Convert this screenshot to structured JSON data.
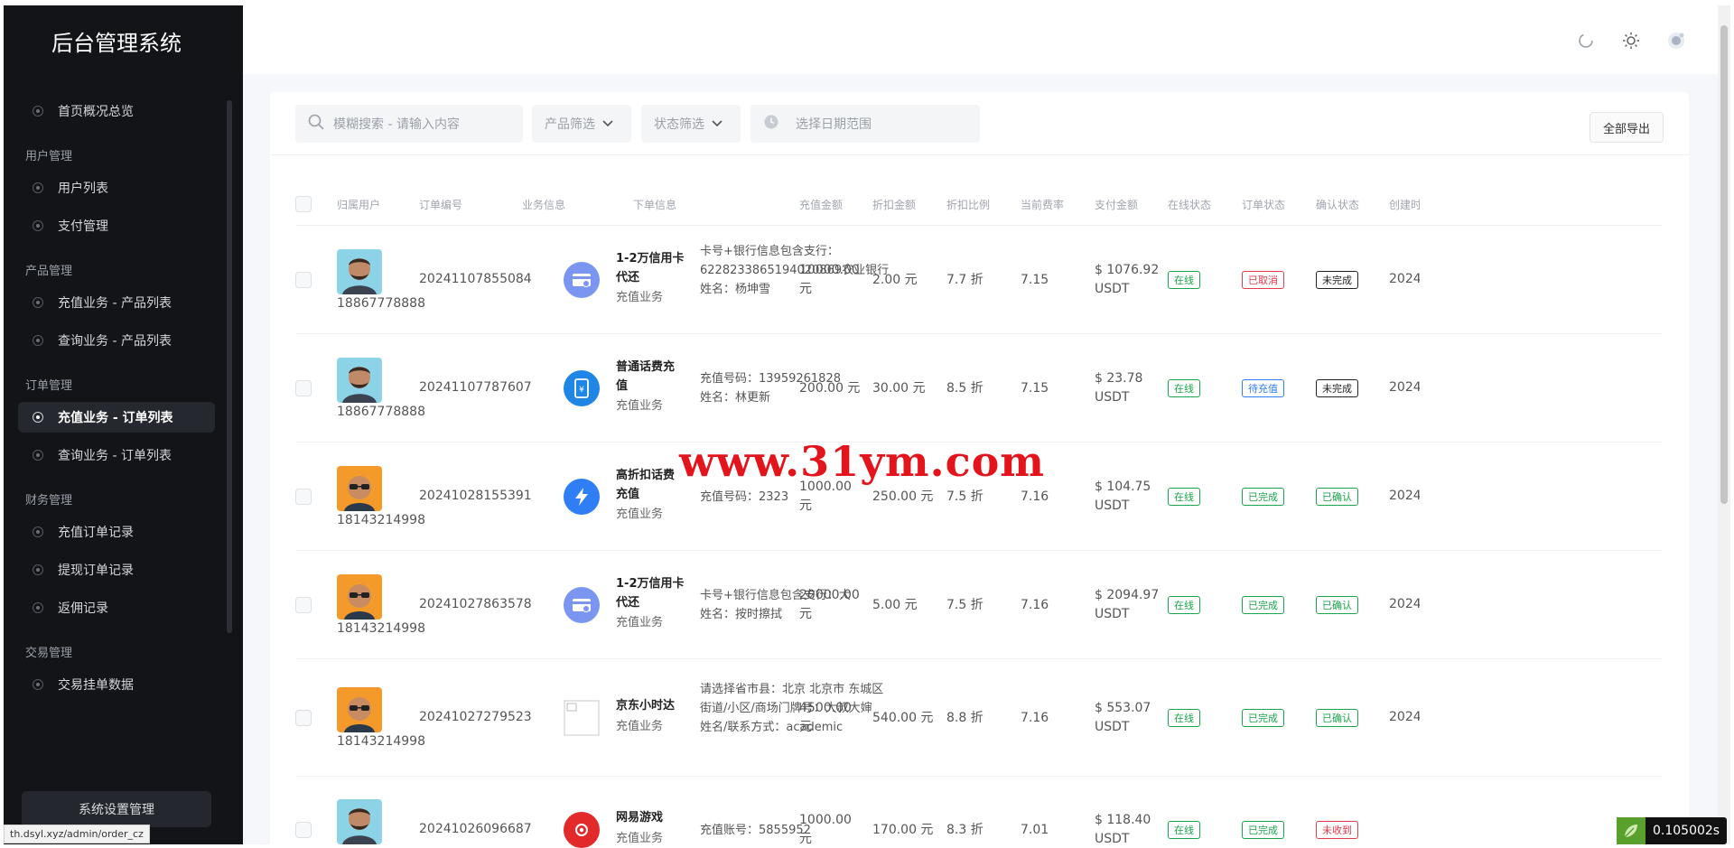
{
  "sidebar": {
    "title": "后台管理系统",
    "settings_label": "系统设置管理",
    "menu": [
      {
        "type": "item",
        "label": "首页概况总览",
        "active": false
      },
      {
        "type": "group",
        "label": "用户管理"
      },
      {
        "type": "item",
        "label": "用户列表",
        "active": false
      },
      {
        "type": "item",
        "label": "支付管理",
        "active": false
      },
      {
        "type": "group",
        "label": "产品管理"
      },
      {
        "type": "item",
        "label": "充值业务 - 产品列表",
        "active": false
      },
      {
        "type": "item",
        "label": "查询业务 - 产品列表",
        "active": false
      },
      {
        "type": "group",
        "label": "订单管理"
      },
      {
        "type": "item",
        "label": "充值业务 - 订单列表",
        "active": true
      },
      {
        "type": "item",
        "label": "查询业务 - 订单列表",
        "active": false
      },
      {
        "type": "group",
        "label": "财务管理"
      },
      {
        "type": "item",
        "label": "充值订单记录",
        "active": false
      },
      {
        "type": "item",
        "label": "提现订单记录",
        "active": false
      },
      {
        "type": "item",
        "label": "返佣记录",
        "active": false
      },
      {
        "type": "group",
        "label": "交易管理"
      },
      {
        "type": "item",
        "label": "交易挂单数据",
        "active": false
      }
    ]
  },
  "status_url": "th.dsyl.xyz/admin/order_cz",
  "filters": {
    "search_placeholder": "模糊搜索 - 请输入内容",
    "product_filter": "产品筛选",
    "status_filter": "状态筛选",
    "date_placeholder": "选择日期范围",
    "export_label": "全部导出"
  },
  "table": {
    "headers": [
      "归属用户",
      "订单编号",
      "业务信息",
      "下单信息",
      "充值金额",
      "折扣金额",
      "折扣比例",
      "当前费率",
      "支付金额",
      "在线状态",
      "订单状态",
      "确认状态",
      "创建时间"
    ],
    "rows": [
      {
        "phone": "18867778888",
        "avatar": "man",
        "order_no": "20241107855084",
        "product_icon": "card",
        "product_name": "1-2万信用卡代还",
        "product_type": "充值业务",
        "info": [
          "卡号+银行信息包含支行：6228233865194020869农业银行",
          "姓名：杨坤雪"
        ],
        "amount": "10000.00 元",
        "discount": "2.00 元",
        "ratio": "7.7 折",
        "rate": "7.15",
        "pay": "$ 1076.92 USDT",
        "online": "在线",
        "order_status": "已取消",
        "order_status_color": "red",
        "confirm": "未完成",
        "confirm_color": "black",
        "created": "2024-"
      },
      {
        "phone": "18867778888",
        "avatar": "man",
        "order_no": "20241107787607",
        "product_icon": "phone",
        "product_name": "普通话费充值",
        "product_type": "充值业务",
        "info": [
          "充值号码：13959261828",
          "姓名：林更新"
        ],
        "amount": "200.00 元",
        "discount": "30.00 元",
        "ratio": "8.5 折",
        "rate": "7.15",
        "pay": "$ 23.78 USDT",
        "online": "在线",
        "order_status": "待充值",
        "order_status_color": "blue",
        "confirm": "未完成",
        "confirm_color": "black",
        "created": "2024-"
      },
      {
        "phone": "18143214998",
        "avatar": "glasses",
        "order_no": "20241028155391",
        "product_icon": "bolt",
        "product_name": "高折扣话费充值",
        "product_type": "充值业务",
        "info": [
          "充值号码：2323"
        ],
        "amount": "1000.00 元",
        "discount": "250.00 元",
        "ratio": "7.5 折",
        "rate": "7.16",
        "pay": "$ 104.75 USDT",
        "online": "在线",
        "order_status": "已完成",
        "order_status_color": "green",
        "confirm": "已确认",
        "confirm_color": "green",
        "created": "2024-"
      },
      {
        "phone": "18143214998",
        "avatar": "glasses",
        "order_no": "20241027863578",
        "product_icon": "card",
        "product_name": "1-2万信用卡代还",
        "product_type": "充值业务",
        "info": [
          "卡号+银行信息包含支行：大",
          "姓名：按时擦拭"
        ],
        "amount": "20000.00 元",
        "discount": "5.00 元",
        "ratio": "7.5 折",
        "rate": "7.16",
        "pay": "$ 2094.97 USDT",
        "online": "在线",
        "order_status": "已完成",
        "order_status_color": "green",
        "confirm": "已确认",
        "confirm_color": "green",
        "created": "2024-"
      },
      {
        "phone": "18143214998",
        "avatar": "glasses",
        "order_no": "20241027279523",
        "product_icon": "broken",
        "product_name": "京东小时达",
        "product_type": "充值业务",
        "info": [
          "请选择省市县：北京 北京市 东城区",
          "街道/小区/商场门牌号：大叔大婶",
          "姓名/联系方式：academic"
        ],
        "amount": "4500.00 元",
        "discount": "540.00 元",
        "ratio": "8.8 折",
        "rate": "7.16",
        "pay": "$ 553.07 USDT",
        "online": "在线",
        "order_status": "已完成",
        "order_status_color": "green",
        "confirm": "已确认",
        "confirm_color": "green",
        "created": "2024-"
      },
      {
        "phone": "",
        "avatar": "man",
        "order_no": "20241026096687",
        "product_icon": "netease",
        "product_name": "网易游戏",
        "product_type": "充值业务",
        "info": [
          "充值账号：5855952"
        ],
        "amount": "1000.00 元",
        "discount": "170.00 元",
        "ratio": "8.3 折",
        "rate": "7.01",
        "pay": "$ 118.40 USDT",
        "online": "在线",
        "order_status": "已完成",
        "order_status_color": "green",
        "confirm": "未收到",
        "confirm_color": "red",
        "created": ""
      }
    ]
  },
  "watermark": "www.31ym.com",
  "timer_value": "0.105002s",
  "icons": {
    "loading": "loading-icon",
    "theme": "sun-icon",
    "avatar": "user-avatar-icon",
    "search": "search-icon",
    "calendar": "clock-icon"
  }
}
